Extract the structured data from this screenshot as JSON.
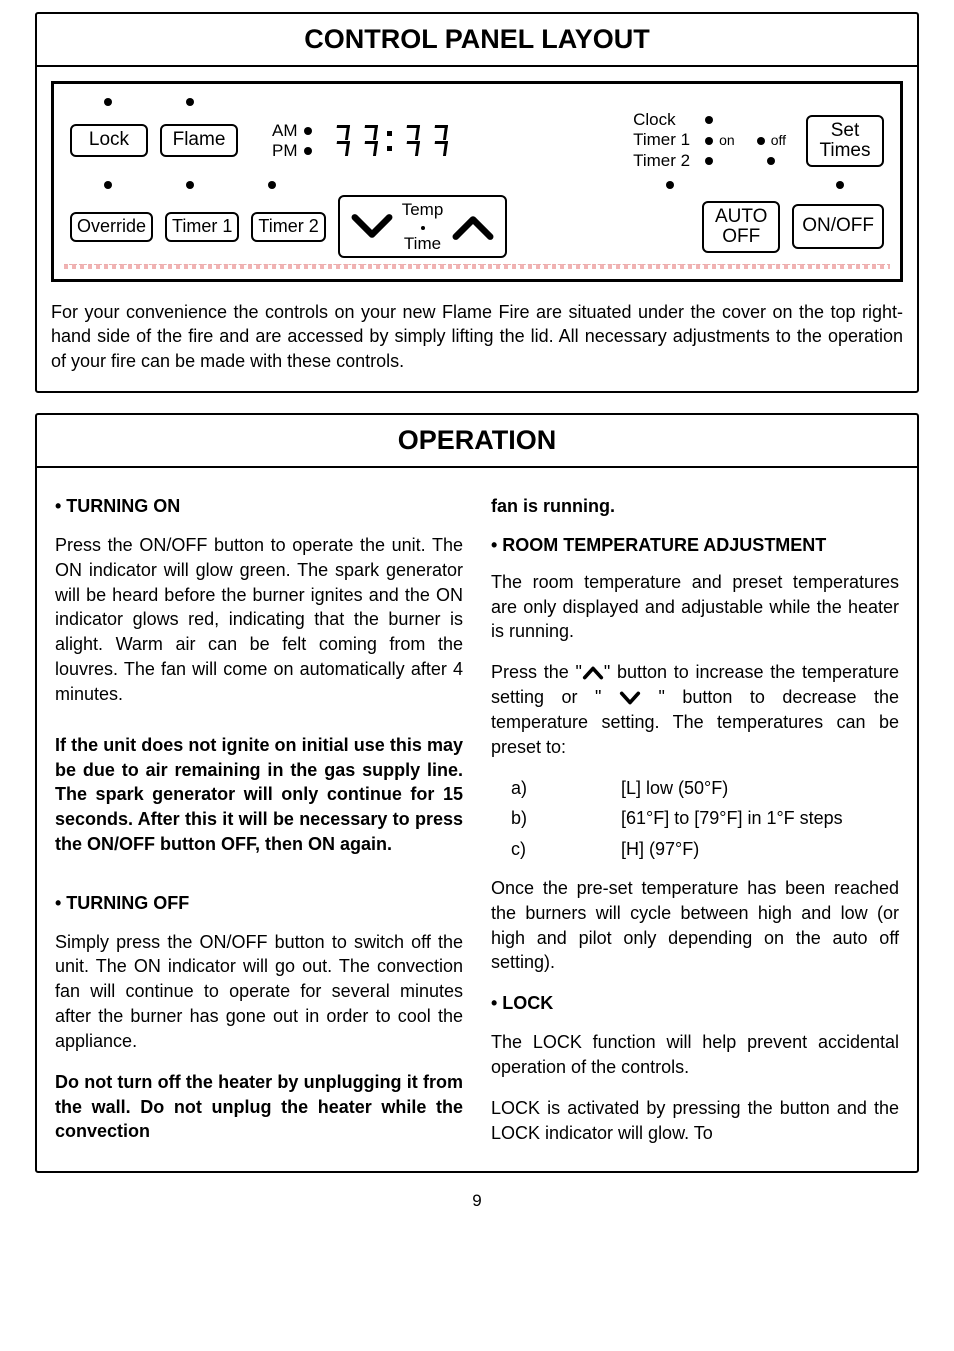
{
  "panel": {
    "title": "CONTROL PANEL LAYOUT",
    "buttons": {
      "lock": "Lock",
      "flame": "Flame",
      "override": "Override",
      "timer1": "Timer 1",
      "timer2": "Timer 2",
      "temp_top": "Temp",
      "temp_bottom": "Time",
      "auto_top": "AUTO",
      "auto_bottom": "OFF",
      "onoff": "ON/OFF",
      "settimes_top": "Set",
      "settimes_bottom": "Times"
    },
    "labels": {
      "am": "AM",
      "pm": "PM",
      "clock": "Clock",
      "t1": "Timer 1",
      "t2": "Timer 2",
      "on": "on",
      "off": "off"
    },
    "description": "For your convenience the controls on your new Flame Fire are situated under the cover on the top right-hand side of the fire and are accessed by simply lifting the lid.  All necessary adjustments to the operation of your fire can be made with these controls."
  },
  "operation": {
    "title": "OPERATION",
    "left": {
      "h_on": "•  TURNING ON",
      "p_on": "Press the ON/OFF button to operate the unit.  The ON indicator will glow green.  The spark generator will be heard before the burner ignites and the ON indicator glows red, indicating that the burner is alight.  Warm air can be felt coming from the louvres.  The fan will come on automatically after 4 minutes.",
      "p_bold": "If the unit does not ignite on initial use this may be due to air remaining in the gas supply line. The spark generator will only continue for 15 seconds. After this it will be necessary to press the ON/OFF button OFF, then ON again.",
      "h_off": "•  TURNING OFF",
      "p_off": "Simply press the ON/OFF button to switch off the unit. The ON indicator will go out.  The convection fan will continue to operate for several minutes after the burner has gone out in order to cool the appliance.",
      "p_warn": "Do not turn off the heater by unplugging it from the wall.  Do not unplug the heater while the convection"
    },
    "right": {
      "p_fan": "fan is running.",
      "h_room": "•  ROOM TEMPERATURE ADJUSTMENT",
      "p_room1": "The room temperature and preset temperatures are only displayed and adjustable while the heater is running.",
      "p_room2a": "Press the \"",
      "p_room2b": "\" button to increase the temperature setting or \" ",
      "p_room2c": " \" button to decrease the temperature setting.  The temperatures can be preset to:",
      "li_a_k": "a)",
      "li_a_v": "[L] low (50°F)",
      "li_b_k": "b)",
      "li_b_v": "[61°F] to [79°F] in 1°F steps",
      "li_c_k": "c)",
      "li_c_v": "[H] (97°F)",
      "p_once": "Once the pre-set temperature has been reached the burners will cycle between high and low (or high and pilot only depending on the auto off setting).",
      "h_lock": "•  LOCK",
      "p_lock1": "The LOCK function will help prevent accidental operation of the controls.",
      "p_lock2": "LOCK is activated by pressing the button and the LOCK indicator will glow.  To"
    }
  },
  "pagenum": "9"
}
